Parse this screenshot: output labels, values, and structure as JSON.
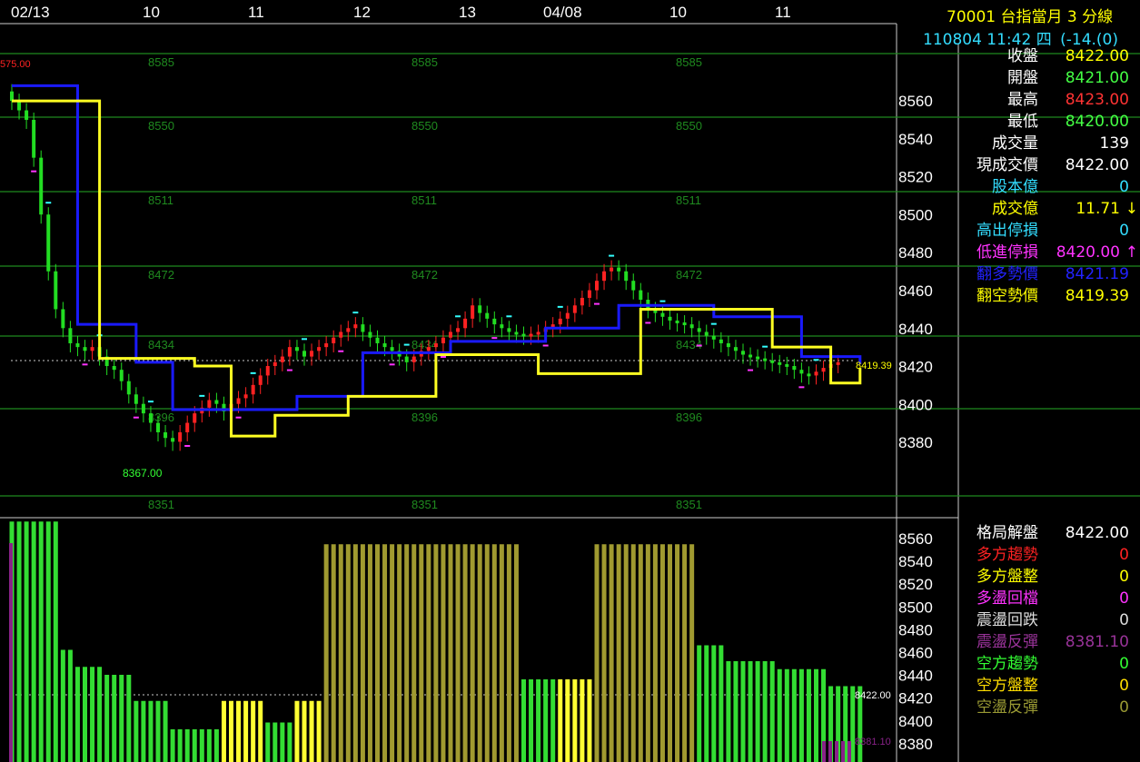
{
  "header": {
    "symbol_title": "70001  台指當月 3 分線",
    "datetime": "110804 11:42 四",
    "change": "(-14.",
    "change_tail": "(0)"
  },
  "x_axis": {
    "labels": [
      "02/13",
      "10",
      "11",
      "12",
      "13",
      "04/08",
      "10",
      "11"
    ]
  },
  "price_axis": {
    "ticks": [
      "8560",
      "8540",
      "8520",
      "8500",
      "8480",
      "8460",
      "8440",
      "8420",
      "8400",
      "8380"
    ]
  },
  "lower_axis": {
    "ticks": [
      "8560",
      "8540",
      "8520",
      "8500",
      "8480",
      "8460",
      "8440",
      "8420",
      "8400",
      "8380"
    ]
  },
  "pivot_labels": [
    "8585",
    "8550",
    "8511",
    "8472",
    "8434",
    "8396",
    "8351"
  ],
  "price_markers": {
    "high_label": "575.00",
    "low_label": "8367.00",
    "current_label": "8419.39",
    "lower_current_label": "8422.00",
    "lower_bottom_label": "8381.10"
  },
  "info_panel": [
    {
      "label": "收盤",
      "value": "8422.00",
      "label_color": "#ffffff",
      "value_color": "#ffff00"
    },
    {
      "label": "開盤",
      "value": "8421.00",
      "label_color": "#ffffff",
      "value_color": "#44ff44"
    },
    {
      "label": "最高",
      "value": "8423.00",
      "label_color": "#ffffff",
      "value_color": "#ff3333"
    },
    {
      "label": "最低",
      "value": "8420.00",
      "label_color": "#ffffff",
      "value_color": "#44ff44"
    },
    {
      "label": "成交量",
      "value": "139",
      "label_color": "#ffffff",
      "value_color": "#ffffff"
    },
    {
      "label": "現成交價",
      "value": "8422.00",
      "label_color": "#ffffff",
      "value_color": "#ffffff"
    },
    {
      "label": "股本億",
      "value": "0",
      "label_color": "#33ddff",
      "value_color": "#33ddff"
    },
    {
      "label": "成交億",
      "value": "11.71",
      "label_color": "#ffff00",
      "value_color": "#ffff00",
      "arrow": "↓",
      "arrow_color": "#ffff00"
    },
    {
      "label": "高出停損",
      "value": "0",
      "label_color": "#33ddff",
      "value_color": "#33ddff"
    },
    {
      "label": "低進停損",
      "value": "8420.00",
      "label_color": "#ff33ff",
      "value_color": "#ff33ff",
      "arrow": "↑",
      "arrow_color": "#ff33ff"
    },
    {
      "label": "翻多勢價",
      "value": "8421.19",
      "label_color": "#2222ff",
      "value_color": "#2222ff"
    },
    {
      "label": "翻空勢價",
      "value": "8419.39",
      "label_color": "#ffff00",
      "value_color": "#ffff00"
    }
  ],
  "status_panel": [
    {
      "label": "格局解盤",
      "value": "8422.00",
      "label_color": "#ffffff",
      "value_color": "#ffffff"
    },
    {
      "label": "多方趨勢",
      "value": "0",
      "label_color": "#ff2222",
      "value_color": "#ff2222"
    },
    {
      "label": "多方盤整",
      "value": "0",
      "label_color": "#ffff00",
      "value_color": "#ffff00"
    },
    {
      "label": "多盪回檔",
      "value": "0",
      "label_color": "#ff33ff",
      "value_color": "#ff33ff"
    },
    {
      "label": "震盪回跌",
      "value": "0",
      "label_color": "#dddddd",
      "value_color": "#dddddd"
    },
    {
      "label": "震盪反彈",
      "value": "8381.10",
      "label_color": "#993399",
      "value_color": "#993399"
    },
    {
      "label": "空方趨勢",
      "value": "0",
      "label_color": "#33ff33",
      "value_color": "#33ff33"
    },
    {
      "label": "空方盤整",
      "value": "0",
      "label_color": "#ffdd00",
      "value_color": "#ffdd00"
    },
    {
      "label": "空盪反彈",
      "value": "0",
      "label_color": "#999933",
      "value_color": "#999933"
    }
  ],
  "colors": {
    "grid": "#1f8a1f",
    "up_candle": "#ff2222",
    "down_candle": "#22dd22",
    "blue_line": "#1a1aff",
    "yellow_line": "#ffff22",
    "olive_bar": "#a09a30",
    "green_bar": "#33dd33",
    "yellow_bar": "#ffff33",
    "purple_bar": "#882288"
  },
  "chart_data": {
    "type": "candlestick",
    "pivot_levels": [
      8585,
      8550,
      8511,
      8472,
      8434,
      8396,
      8351
    ],
    "current_price": 8419.39,
    "ylim": [
      8370,
      8575
    ],
    "closes": [
      8560,
      8555,
      8550,
      8530,
      8500,
      8470,
      8450,
      8440,
      8432,
      8430,
      8428,
      8430,
      8425,
      8420,
      8418,
      8412,
      8405,
      8400,
      8395,
      8390,
      8385,
      8382,
      8380,
      8385,
      8390,
      8395,
      8398,
      8402,
      8400,
      8396,
      8400,
      8403,
      8405,
      8410,
      8415,
      8420,
      8422,
      8425,
      8430,
      8428,
      8425,
      8428,
      8430,
      8432,
      8435,
      8438,
      8440,
      8442,
      8438,
      8435,
      8432,
      8430,
      8428,
      8425,
      8422,
      8425,
      8428,
      8430,
      8432,
      8435,
      8438,
      8440,
      8445,
      8452,
      8448,
      8445,
      8442,
      8440,
      8438,
      8437,
      8436,
      8437,
      8438,
      8440,
      8442,
      8445,
      8448,
      8452,
      8456,
      8460,
      8465,
      8470,
      8472,
      8470,
      8465,
      8460,
      8455,
      8450,
      8448,
      8446,
      8444,
      8443,
      8442,
      8440,
      8438,
      8436,
      8434,
      8432,
      8430,
      8428,
      8426,
      8425,
      8424,
      8423,
      8422,
      8421,
      8420,
      8418,
      8416,
      8415,
      8417,
      8419,
      8421,
      8422
    ],
    "blue_line": [
      {
        "i": 0,
        "v": 8568
      },
      {
        "i": 6,
        "v": 8568
      },
      {
        "i": 9,
        "v": 8442
      },
      {
        "i": 17,
        "v": 8422
      },
      {
        "i": 22,
        "v": 8397
      },
      {
        "i": 39,
        "v": 8404
      },
      {
        "i": 48,
        "v": 8427
      },
      {
        "i": 60,
        "v": 8433
      },
      {
        "i": 73,
        "v": 8440
      },
      {
        "i": 83,
        "v": 8452
      },
      {
        "i": 96,
        "v": 8446
      },
      {
        "i": 108,
        "v": 8425
      },
      {
        "i": 116,
        "v": 8421
      }
    ],
    "yellow_line": [
      {
        "i": 0,
        "v": 8560
      },
      {
        "i": 10,
        "v": 8560
      },
      {
        "i": 12,
        "v": 8424
      },
      {
        "i": 25,
        "v": 8420
      },
      {
        "i": 30,
        "v": 8383
      },
      {
        "i": 36,
        "v": 8394
      },
      {
        "i": 46,
        "v": 8404
      },
      {
        "i": 58,
        "v": 8426
      },
      {
        "i": 72,
        "v": 8416
      },
      {
        "i": 86,
        "v": 8450
      },
      {
        "i": 104,
        "v": 8430
      },
      {
        "i": 112,
        "v": 8411
      },
      {
        "i": 116,
        "v": 8419
      }
    ],
    "lower_bars_note": "regime bars at 8422 range",
    "lower_bars": [
      {
        "from": 0,
        "to": 6,
        "value": 8575,
        "kind": "green"
      },
      {
        "from": 7,
        "to": 8,
        "value": 8462,
        "kind": "green"
      },
      {
        "from": 9,
        "to": 12,
        "value": 8447,
        "kind": "green"
      },
      {
        "from": 13,
        "to": 16,
        "value": 8440,
        "kind": "green"
      },
      {
        "from": 17,
        "to": 21,
        "value": 8417,
        "kind": "green"
      },
      {
        "from": 22,
        "to": 28,
        "value": 8392,
        "kind": "green"
      },
      {
        "from": 29,
        "to": 34,
        "value": 8417,
        "kind": "yellow"
      },
      {
        "from": 35,
        "to": 38,
        "value": 8398,
        "kind": "green"
      },
      {
        "from": 39,
        "to": 42,
        "value": 8417,
        "kind": "yellow"
      },
      {
        "from": 43,
        "to": 69,
        "value": 8555,
        "kind": "olive"
      },
      {
        "from": 70,
        "to": 74,
        "value": 8436,
        "kind": "green"
      },
      {
        "from": 75,
        "to": 79,
        "value": 8436,
        "kind": "yellow"
      },
      {
        "from": 80,
        "to": 93,
        "value": 8555,
        "kind": "olive"
      },
      {
        "from": 94,
        "to": 97,
        "value": 8466,
        "kind": "green"
      },
      {
        "from": 98,
        "to": 104,
        "value": 8452,
        "kind": "green"
      },
      {
        "from": 105,
        "to": 111,
        "value": 8445,
        "kind": "green"
      },
      {
        "from": 112,
        "to": 116,
        "value": 8430,
        "kind": "green"
      }
    ]
  }
}
